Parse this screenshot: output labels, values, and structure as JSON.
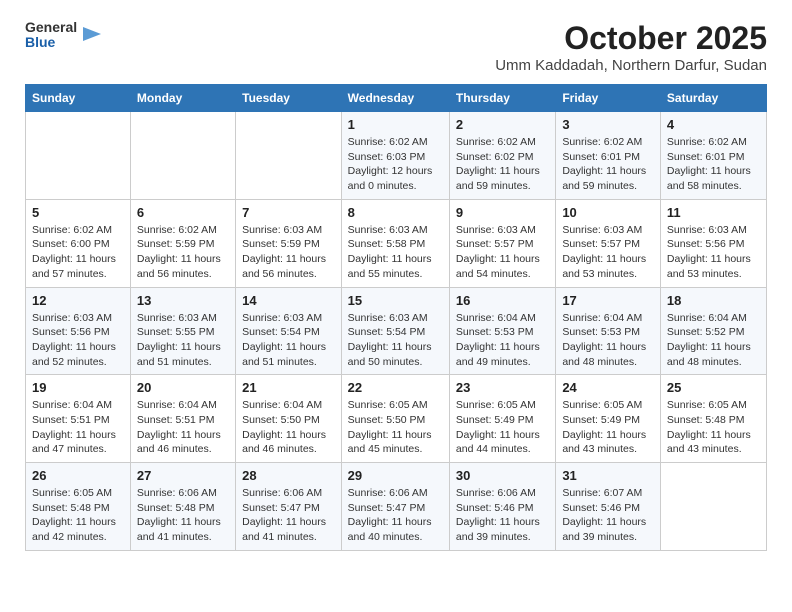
{
  "header": {
    "logo_general": "General",
    "logo_blue": "Blue",
    "month_title": "October 2025",
    "location": "Umm Kaddadah, Northern Darfur, Sudan"
  },
  "days_of_week": [
    "Sunday",
    "Monday",
    "Tuesday",
    "Wednesday",
    "Thursday",
    "Friday",
    "Saturday"
  ],
  "weeks": [
    [
      {
        "day": "",
        "sunrise": "",
        "sunset": "",
        "daylight": ""
      },
      {
        "day": "",
        "sunrise": "",
        "sunset": "",
        "daylight": ""
      },
      {
        "day": "",
        "sunrise": "",
        "sunset": "",
        "daylight": ""
      },
      {
        "day": "1",
        "sunrise": "Sunrise: 6:02 AM",
        "sunset": "Sunset: 6:03 PM",
        "daylight": "Daylight: 12 hours and 0 minutes."
      },
      {
        "day": "2",
        "sunrise": "Sunrise: 6:02 AM",
        "sunset": "Sunset: 6:02 PM",
        "daylight": "Daylight: 11 hours and 59 minutes."
      },
      {
        "day": "3",
        "sunrise": "Sunrise: 6:02 AM",
        "sunset": "Sunset: 6:01 PM",
        "daylight": "Daylight: 11 hours and 59 minutes."
      },
      {
        "day": "4",
        "sunrise": "Sunrise: 6:02 AM",
        "sunset": "Sunset: 6:01 PM",
        "daylight": "Daylight: 11 hours and 58 minutes."
      }
    ],
    [
      {
        "day": "5",
        "sunrise": "Sunrise: 6:02 AM",
        "sunset": "Sunset: 6:00 PM",
        "daylight": "Daylight: 11 hours and 57 minutes."
      },
      {
        "day": "6",
        "sunrise": "Sunrise: 6:02 AM",
        "sunset": "Sunset: 5:59 PM",
        "daylight": "Daylight: 11 hours and 56 minutes."
      },
      {
        "day": "7",
        "sunrise": "Sunrise: 6:03 AM",
        "sunset": "Sunset: 5:59 PM",
        "daylight": "Daylight: 11 hours and 56 minutes."
      },
      {
        "day": "8",
        "sunrise": "Sunrise: 6:03 AM",
        "sunset": "Sunset: 5:58 PM",
        "daylight": "Daylight: 11 hours and 55 minutes."
      },
      {
        "day": "9",
        "sunrise": "Sunrise: 6:03 AM",
        "sunset": "Sunset: 5:57 PM",
        "daylight": "Daylight: 11 hours and 54 minutes."
      },
      {
        "day": "10",
        "sunrise": "Sunrise: 6:03 AM",
        "sunset": "Sunset: 5:57 PM",
        "daylight": "Daylight: 11 hours and 53 minutes."
      },
      {
        "day": "11",
        "sunrise": "Sunrise: 6:03 AM",
        "sunset": "Sunset: 5:56 PM",
        "daylight": "Daylight: 11 hours and 53 minutes."
      }
    ],
    [
      {
        "day": "12",
        "sunrise": "Sunrise: 6:03 AM",
        "sunset": "Sunset: 5:56 PM",
        "daylight": "Daylight: 11 hours and 52 minutes."
      },
      {
        "day": "13",
        "sunrise": "Sunrise: 6:03 AM",
        "sunset": "Sunset: 5:55 PM",
        "daylight": "Daylight: 11 hours and 51 minutes."
      },
      {
        "day": "14",
        "sunrise": "Sunrise: 6:03 AM",
        "sunset": "Sunset: 5:54 PM",
        "daylight": "Daylight: 11 hours and 51 minutes."
      },
      {
        "day": "15",
        "sunrise": "Sunrise: 6:03 AM",
        "sunset": "Sunset: 5:54 PM",
        "daylight": "Daylight: 11 hours and 50 minutes."
      },
      {
        "day": "16",
        "sunrise": "Sunrise: 6:04 AM",
        "sunset": "Sunset: 5:53 PM",
        "daylight": "Daylight: 11 hours and 49 minutes."
      },
      {
        "day": "17",
        "sunrise": "Sunrise: 6:04 AM",
        "sunset": "Sunset: 5:53 PM",
        "daylight": "Daylight: 11 hours and 48 minutes."
      },
      {
        "day": "18",
        "sunrise": "Sunrise: 6:04 AM",
        "sunset": "Sunset: 5:52 PM",
        "daylight": "Daylight: 11 hours and 48 minutes."
      }
    ],
    [
      {
        "day": "19",
        "sunrise": "Sunrise: 6:04 AM",
        "sunset": "Sunset: 5:51 PM",
        "daylight": "Daylight: 11 hours and 47 minutes."
      },
      {
        "day": "20",
        "sunrise": "Sunrise: 6:04 AM",
        "sunset": "Sunset: 5:51 PM",
        "daylight": "Daylight: 11 hours and 46 minutes."
      },
      {
        "day": "21",
        "sunrise": "Sunrise: 6:04 AM",
        "sunset": "Sunset: 5:50 PM",
        "daylight": "Daylight: 11 hours and 46 minutes."
      },
      {
        "day": "22",
        "sunrise": "Sunrise: 6:05 AM",
        "sunset": "Sunset: 5:50 PM",
        "daylight": "Daylight: 11 hours and 45 minutes."
      },
      {
        "day": "23",
        "sunrise": "Sunrise: 6:05 AM",
        "sunset": "Sunset: 5:49 PM",
        "daylight": "Daylight: 11 hours and 44 minutes."
      },
      {
        "day": "24",
        "sunrise": "Sunrise: 6:05 AM",
        "sunset": "Sunset: 5:49 PM",
        "daylight": "Daylight: 11 hours and 43 minutes."
      },
      {
        "day": "25",
        "sunrise": "Sunrise: 6:05 AM",
        "sunset": "Sunset: 5:48 PM",
        "daylight": "Daylight: 11 hours and 43 minutes."
      }
    ],
    [
      {
        "day": "26",
        "sunrise": "Sunrise: 6:05 AM",
        "sunset": "Sunset: 5:48 PM",
        "daylight": "Daylight: 11 hours and 42 minutes."
      },
      {
        "day": "27",
        "sunrise": "Sunrise: 6:06 AM",
        "sunset": "Sunset: 5:48 PM",
        "daylight": "Daylight: 11 hours and 41 minutes."
      },
      {
        "day": "28",
        "sunrise": "Sunrise: 6:06 AM",
        "sunset": "Sunset: 5:47 PM",
        "daylight": "Daylight: 11 hours and 41 minutes."
      },
      {
        "day": "29",
        "sunrise": "Sunrise: 6:06 AM",
        "sunset": "Sunset: 5:47 PM",
        "daylight": "Daylight: 11 hours and 40 minutes."
      },
      {
        "day": "30",
        "sunrise": "Sunrise: 6:06 AM",
        "sunset": "Sunset: 5:46 PM",
        "daylight": "Daylight: 11 hours and 39 minutes."
      },
      {
        "day": "31",
        "sunrise": "Sunrise: 6:07 AM",
        "sunset": "Sunset: 5:46 PM",
        "daylight": "Daylight: 11 hours and 39 minutes."
      },
      {
        "day": "",
        "sunrise": "",
        "sunset": "",
        "daylight": ""
      }
    ]
  ]
}
